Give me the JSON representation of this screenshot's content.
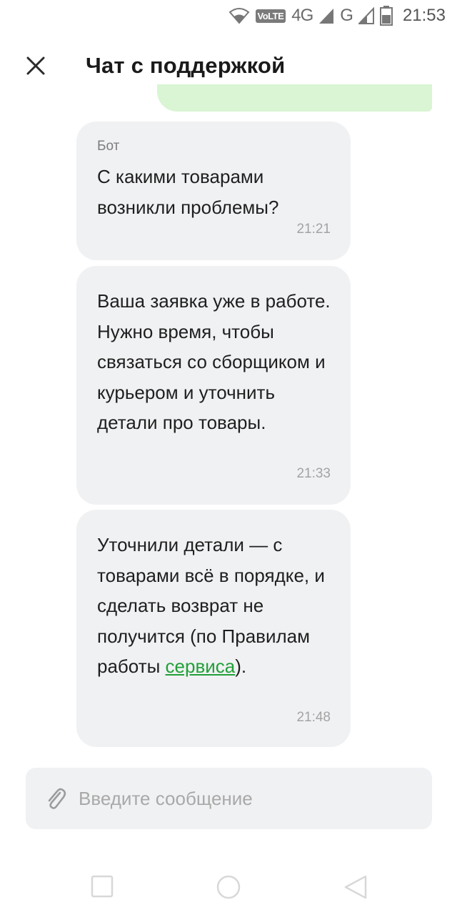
{
  "status_bar": {
    "volte": "VoLTE",
    "network_1": "4G",
    "network_2": "G",
    "time": "21:53"
  },
  "header": {
    "title": "Чат с поддержкой"
  },
  "messages": [
    {
      "sender": "Бот",
      "text": "С какими товарами возникли проблемы?",
      "time": "21:21"
    },
    {
      "text": "Ваша заявка уже в работе. Нужно время, чтобы связаться со сборщиком и курьером и уточнить детали про товары.",
      "time": "21:33"
    },
    {
      "text_before_link": "Уточнили детали — с товарами всё в порядке, и сделать возврат не получится (по Правилам работы ",
      "link": "сервиса",
      "text_after_link": ").",
      "time": "21:48"
    }
  ],
  "composer": {
    "placeholder": "Введите сообщение"
  },
  "colors": {
    "accent": "#21a038",
    "sent_bubble": "#d9f5d3",
    "received_bubble": "#f0f1f3"
  }
}
